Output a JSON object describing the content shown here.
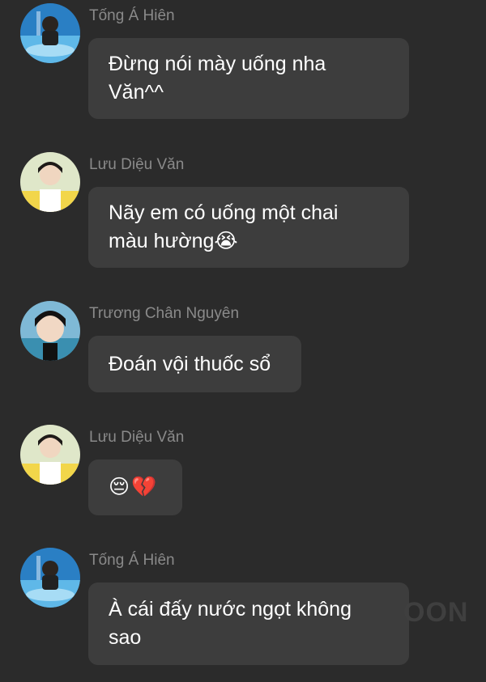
{
  "messages": [
    {
      "sender": "Tống Á Hiên",
      "avatar": "blue-pool-avatar",
      "text": "Đừng nói mày uống nha\nVăn^^"
    },
    {
      "sender": "Lưu Diệu Văn",
      "avatar": "yellow-shirt-avatar",
      "text": "Nãy em có uống một chai\nmàu hường😭"
    },
    {
      "sender": "Trương Chân Nguyên",
      "avatar": "selfie-avatar",
      "text": "Đoán vội thuốc sổ"
    },
    {
      "sender": "Lưu Diệu Văn",
      "avatar": "yellow-shirt-avatar",
      "text": "",
      "emojis": [
        "😔",
        "💔"
      ]
    },
    {
      "sender": "Tống Á Hiên",
      "avatar": "blue-pool-avatar",
      "text": "À cái đấy nước ngọt không\nsao"
    }
  ],
  "watermark": "OON"
}
